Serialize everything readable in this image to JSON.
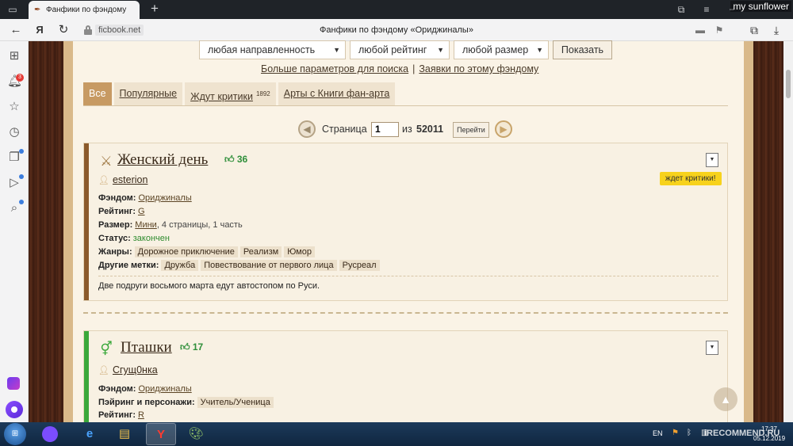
{
  "browser": {
    "tab_title": "Фанфики по фэндому «Ор",
    "user_label": "my sunflower",
    "address": {
      "domain": "ficbook.net",
      "page_title": "Фанфики по фэндому «Ориджиналы»"
    },
    "sidebar_badge": "3"
  },
  "search": {
    "direction": "любая направленность",
    "rating": "любой рейтинг",
    "size": "любой размер",
    "show_button": "Показать",
    "more_params_link": "Больше параметров для поиска",
    "separator": "|",
    "requests_link": "Заявки по этому фэндому"
  },
  "tabs": [
    {
      "label": "Все",
      "count": ""
    },
    {
      "label": "Популярные",
      "count": ""
    },
    {
      "label": "Ждут критики",
      "count": "1892"
    },
    {
      "label": "Арты с Книги фан-арта",
      "count": ""
    }
  ],
  "pager": {
    "label": "Страница",
    "current": "1",
    "of": "из",
    "total": "52011",
    "go_button": "Перейти"
  },
  "fics": [
    {
      "title": "Женский день",
      "likes": "36",
      "author": "esterion",
      "fandom_label": "Фэндом:",
      "fandom": "Ориджиналы",
      "rating_label": "Рейтинг:",
      "rating": "G",
      "size_label": "Размер:",
      "size_link": "Мини",
      "size_rest": ", 4 страницы, 1 часть",
      "status_label": "Статус:",
      "status": "закончен",
      "genres_label": "Жанры:",
      "genres": [
        "Дорожное приключение",
        "Реализм",
        "Юмор"
      ],
      "tags_label": "Другие метки:",
      "tags": [
        "Дружба",
        "Повествование от первого лица",
        "Русреал"
      ],
      "description": "Две подруги восьмого марта едут автостопом по Руси.",
      "critic_badge": "ждет критики!",
      "stripe_color": "#8b5a2b"
    },
    {
      "title": "Пташки",
      "likes": "17",
      "author": "Сгущ0нка",
      "fandom_label": "Фэндом:",
      "fandom": "Ориджиналы",
      "pairing_label": "Пэйринг и персонажи:",
      "pairing": "Учитель/Ученица",
      "rating_label": "Рейтинг:",
      "rating": "R",
      "stripe_color": "#3aa83a"
    }
  ],
  "taskbar": {
    "lang": "EN",
    "time": "17:37",
    "date": "05.12.2019"
  },
  "watermark": "iRECOMMEND.RU"
}
